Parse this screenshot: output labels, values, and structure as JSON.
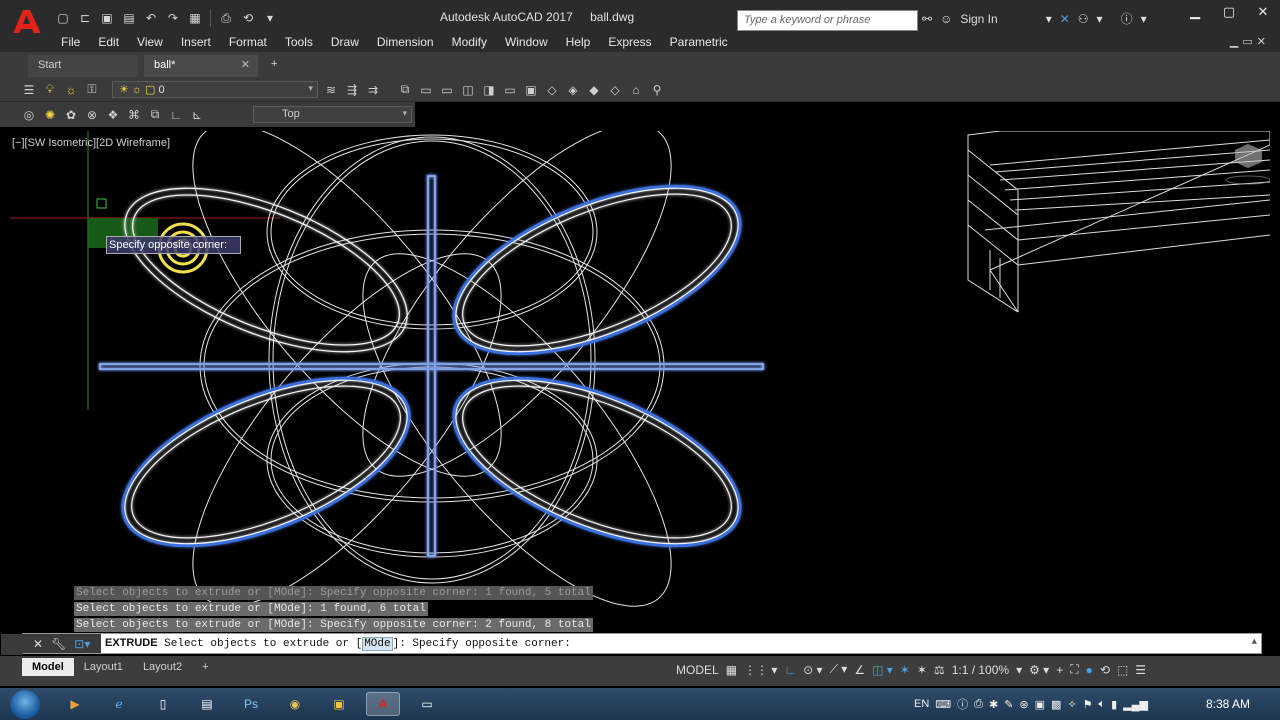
{
  "window": {
    "app_title": "Autodesk AutoCAD 2017",
    "file_name": "ball.dwg",
    "search_placeholder": "Type a keyword or phrase",
    "sign_in": "Sign In"
  },
  "menu": [
    "File",
    "Edit",
    "View",
    "Insert",
    "Format",
    "Tools",
    "Draw",
    "Dimension",
    "Modify",
    "Window",
    "Help",
    "Express",
    "Parametric"
  ],
  "tabs": {
    "start": "Start",
    "active": "ball*",
    "add": "+"
  },
  "toolbar": {
    "layer_value": "0",
    "view_value": "Top"
  },
  "viewport": {
    "label": "[−][SW Isometric][2D Wireframe]"
  },
  "tooltip": "Specify opposite corner:",
  "command": {
    "history": [
      "Select objects to extrude or [MOde]: Specify opposite corner: 1 found, 5 total",
      "Select objects to extrude or [MOde]: 1 found, 6 total",
      "Select objects to extrude or [MOde]: Specify opposite corner: 2 found, 8 total"
    ],
    "command_name": "EXTRUDE",
    "prompt_before": " Select objects to extrude or [",
    "prompt_option": "MOde",
    "prompt_after": "]: Specify opposite corner:"
  },
  "layout_tabs": [
    "Model",
    "Layout1",
    "Layout2"
  ],
  "status": {
    "model": "MODEL",
    "scale": "1:1 / 100%"
  },
  "taskbar": {
    "language": "EN",
    "clock": "8:38 AM"
  },
  "colors": {
    "accent": "#4d9fe3",
    "selected_outline": "#3b6fe0",
    "wire": "#e8e8e8"
  }
}
